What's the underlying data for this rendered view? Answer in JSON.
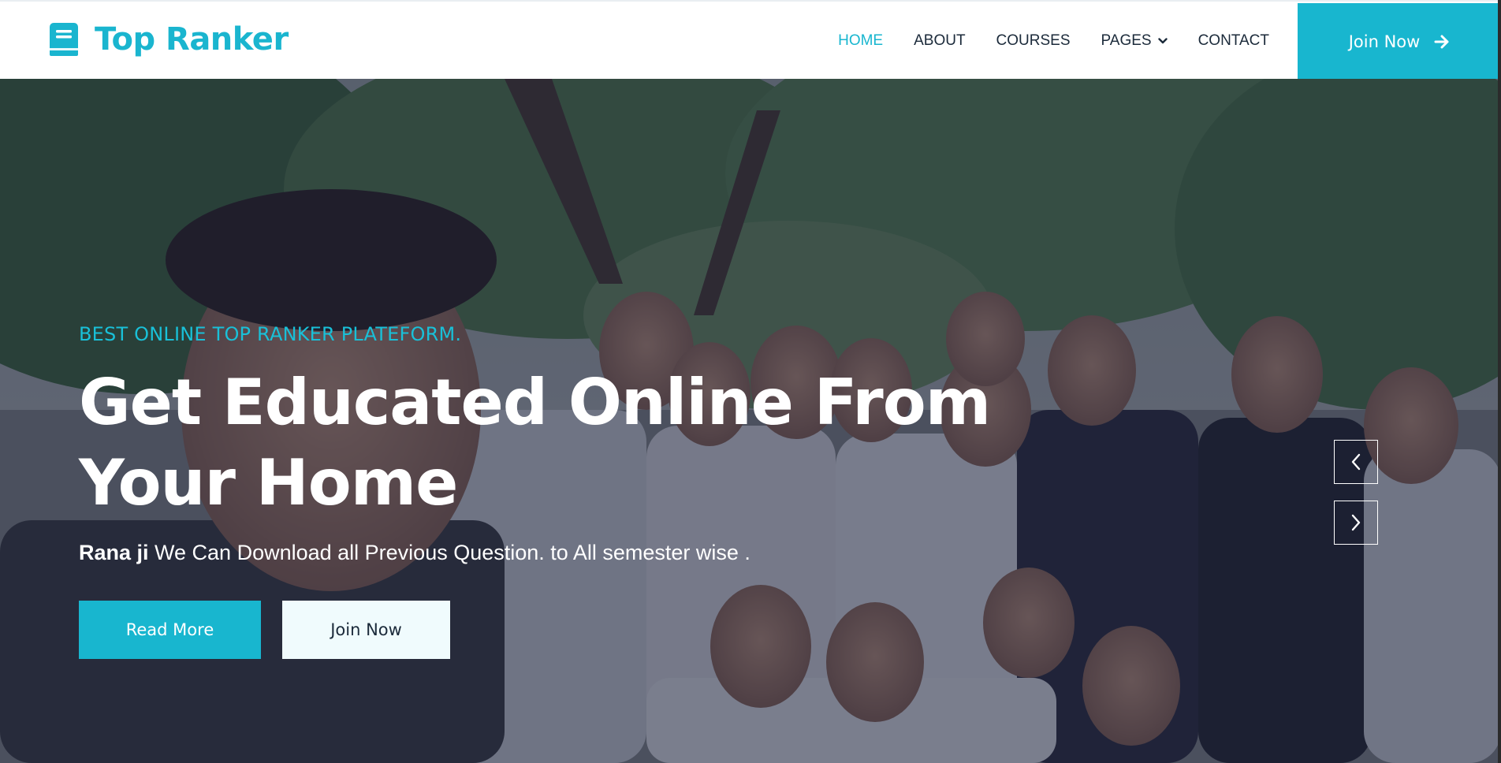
{
  "brand": {
    "name": "Top Ranker",
    "color": "#1ab5cf",
    "icon": "book-icon"
  },
  "nav": {
    "items": [
      {
        "label": "HOME",
        "active": true
      },
      {
        "label": "ABOUT",
        "active": false
      },
      {
        "label": "COURSES",
        "active": false
      },
      {
        "label": "PAGES",
        "active": false,
        "icon": "chevron-down-icon"
      },
      {
        "label": "CONTACT",
        "active": false
      }
    ],
    "join_label": "Join Now",
    "join_icon": "arrow-right-icon"
  },
  "hero": {
    "eyebrow": "BEST ONLINE TOP RANKER PLATEFORM.",
    "headline_line1": "Get Educated Online From",
    "headline_line2": "Your Home",
    "subline_name": "Rana ji",
    "subline_text": " We Can Download all Previous Question. to All semester wise .",
    "primary_button": "Read More",
    "secondary_button": "Join Now",
    "prev_icon": "chevron-left-icon",
    "next_icon": "chevron-right-icon"
  },
  "colors": {
    "accent": "#18b6cf",
    "text_dark": "#1b2a3a",
    "overlay": "#181d38"
  }
}
